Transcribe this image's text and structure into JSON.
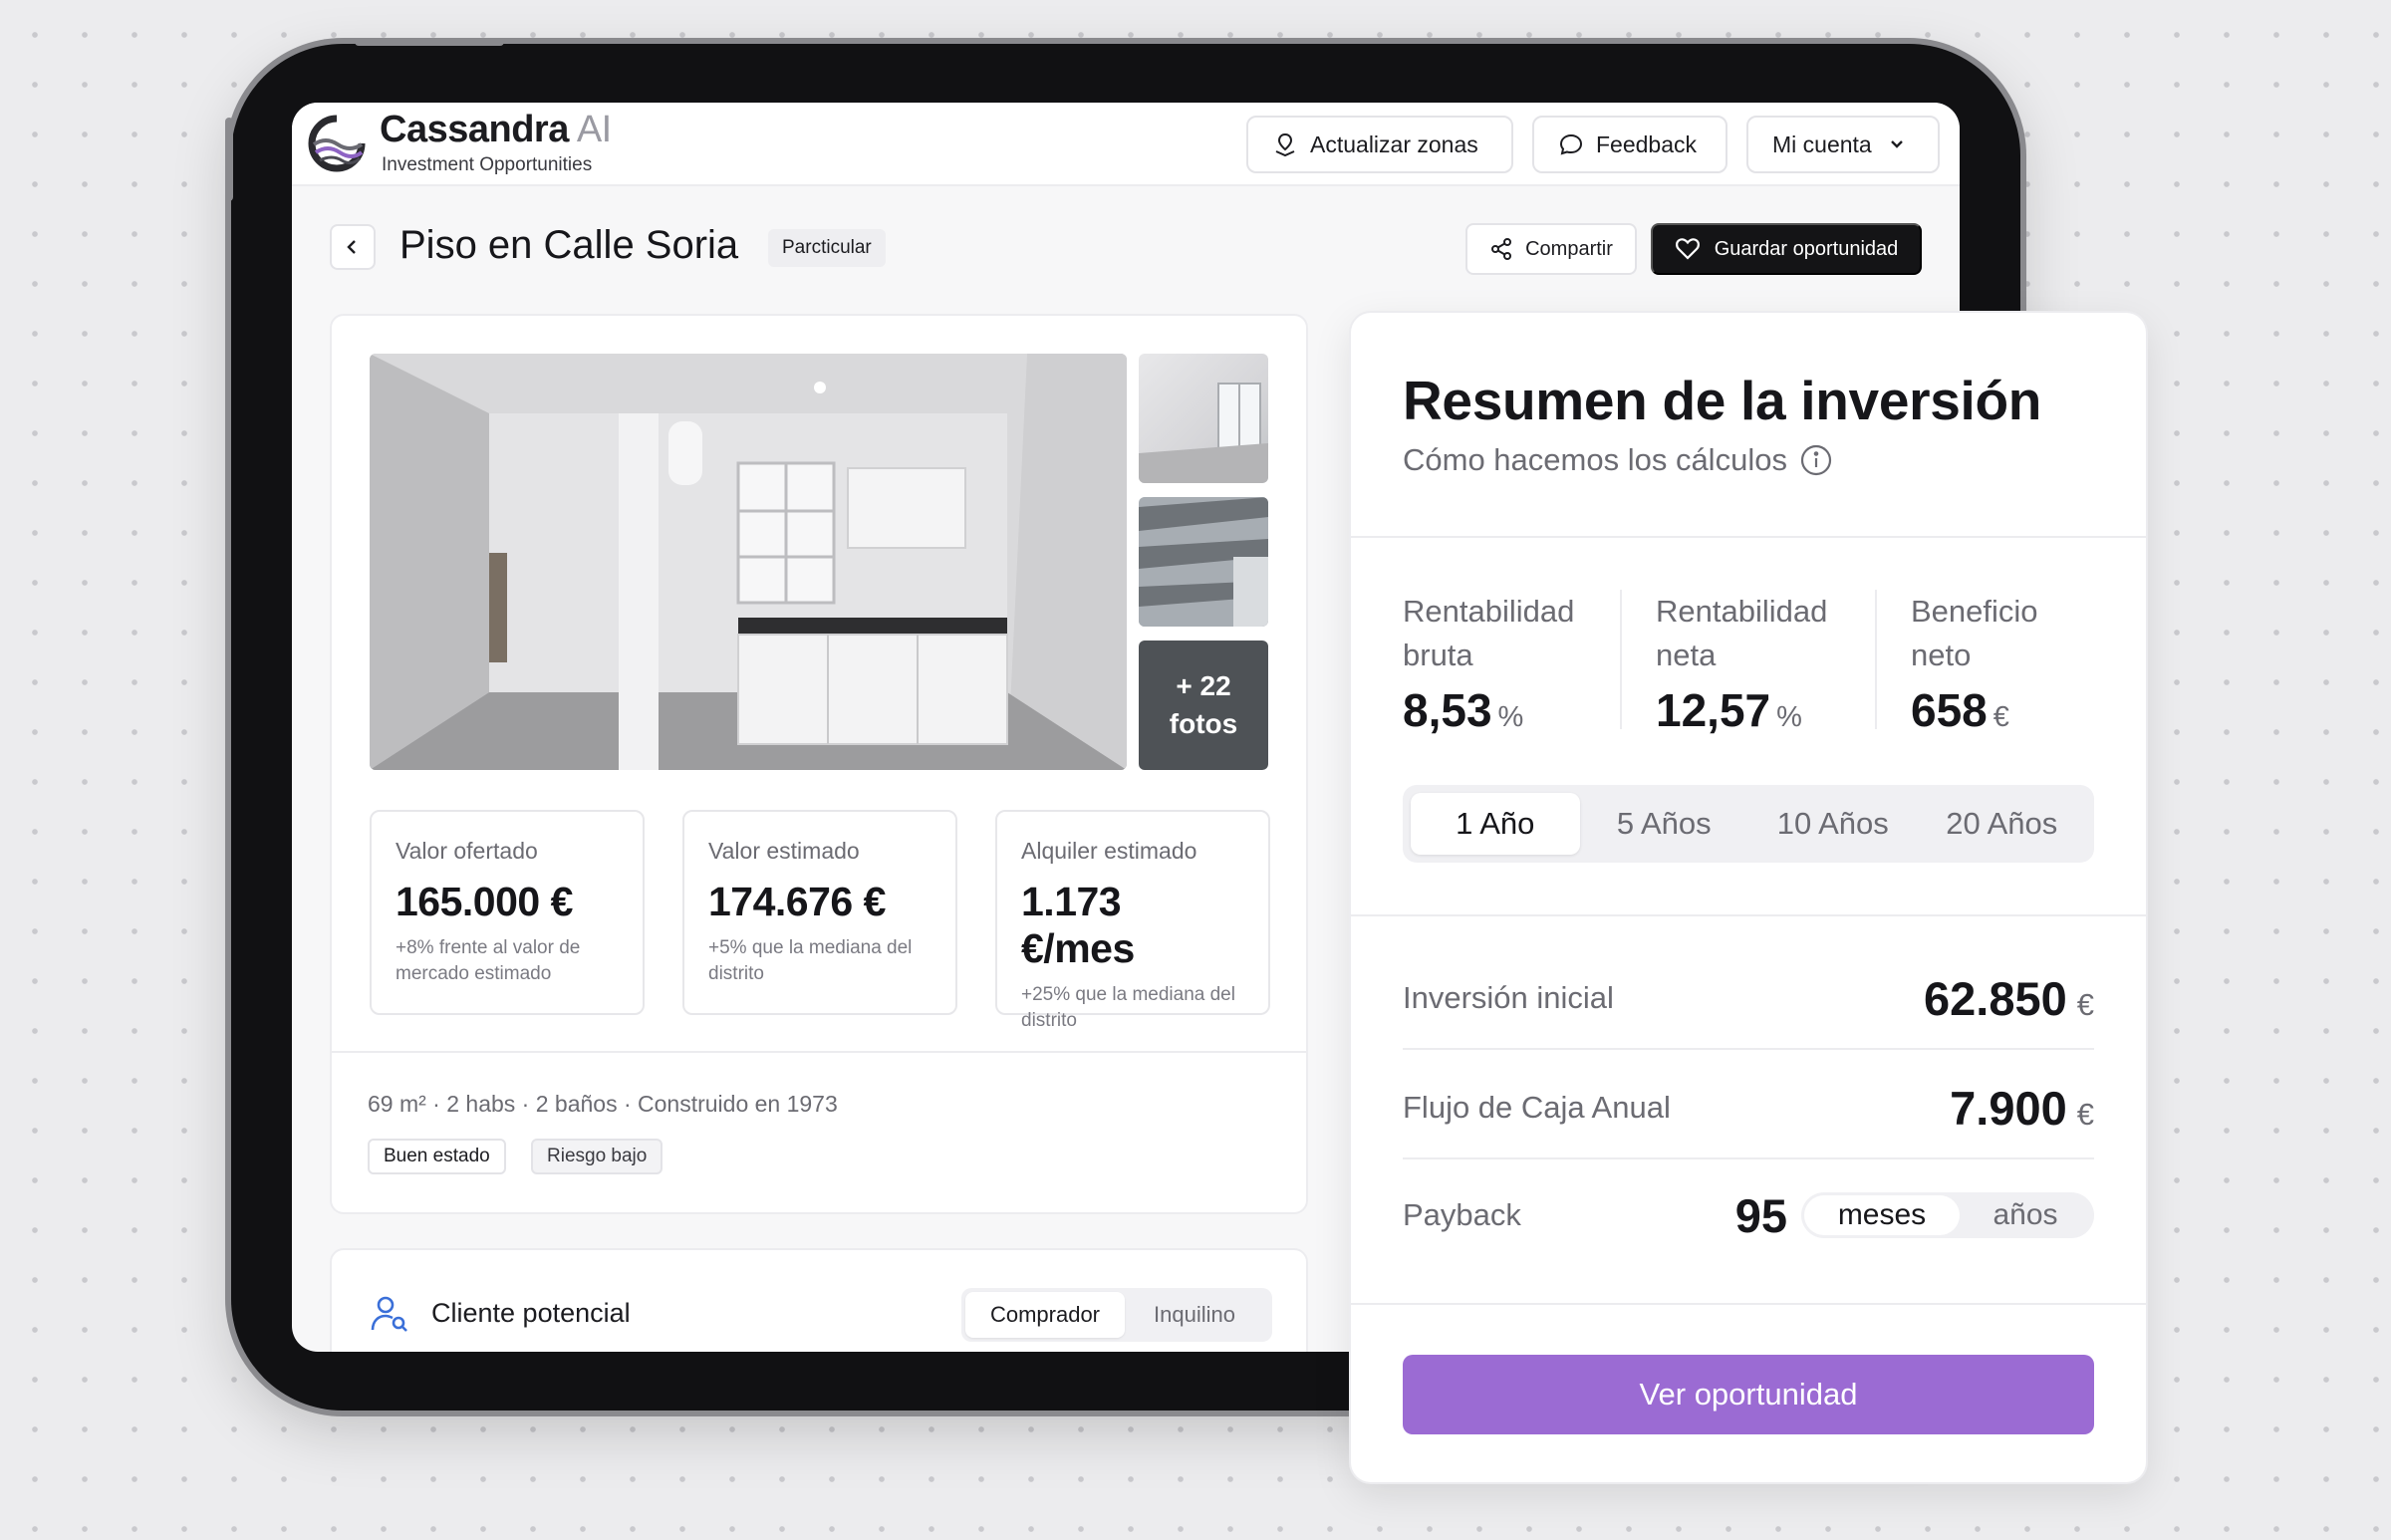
{
  "app": {
    "brand": "Cassandra",
    "brand_suffix": "AI",
    "tagline": "Investment Opportunities",
    "nav": {
      "update_zones": "Actualizar zonas",
      "feedback": "Feedback",
      "account": "Mi cuenta"
    }
  },
  "property": {
    "title": "Piso en Calle Soria",
    "seller_type": "Parcticular",
    "share": "Compartir",
    "save": "Guardar oportunidad",
    "more_photos": "+ 22 fotos",
    "stats": [
      {
        "label": "Valor ofertado",
        "value": "165.000 €",
        "note": "+8% frente al valor de mercado estimado"
      },
      {
        "label": "Valor estimado",
        "value": "174.676 €",
        "note": "+5% que la mediana del distrito"
      },
      {
        "label": "Alquiler estimado",
        "value": "1.173 €/mes",
        "note": "+25% que la mediana del distrito"
      }
    ],
    "features": "69 m² · 2 habs · 2 baños · Construido en 1973",
    "tags": [
      "Buen estado",
      "Riesgo bajo"
    ]
  },
  "client": {
    "label": "Cliente potencial",
    "options": [
      "Comprador",
      "Inquilino"
    ],
    "selected": "Comprador"
  },
  "summary": {
    "title": "Resumen de la inversión",
    "subtitle": "Cómo hacemos los cálculos",
    "metrics": [
      {
        "label_1": "Rentabilidad",
        "label_2": "bruta",
        "value": "8,53",
        "unit": "%"
      },
      {
        "label_1": "Rentabilidad",
        "label_2": "neta",
        "value": "12,57",
        "unit": "%"
      },
      {
        "label_1": "Beneficio",
        "label_2": "neto",
        "value": "658",
        "unit": "€"
      }
    ],
    "periods": [
      "1 Año",
      "5 Años",
      "10 Años",
      "20 Años"
    ],
    "selected_period": "1 Año",
    "rows": {
      "initial_investment": {
        "label": "Inversión inicial",
        "value": "62.850",
        "unit": "€"
      },
      "cash_flow": {
        "label": "Flujo de Caja Anual",
        "value": "7.900",
        "unit": "€"
      },
      "payback": {
        "label": "Payback",
        "value": "95",
        "units": [
          "meses",
          "años"
        ],
        "selected_unit": "meses"
      }
    },
    "cta": "Ver oportunidad"
  },
  "colors": {
    "accent": "#9b6bd3",
    "dark_button": "#141416",
    "background": "#ececee"
  }
}
